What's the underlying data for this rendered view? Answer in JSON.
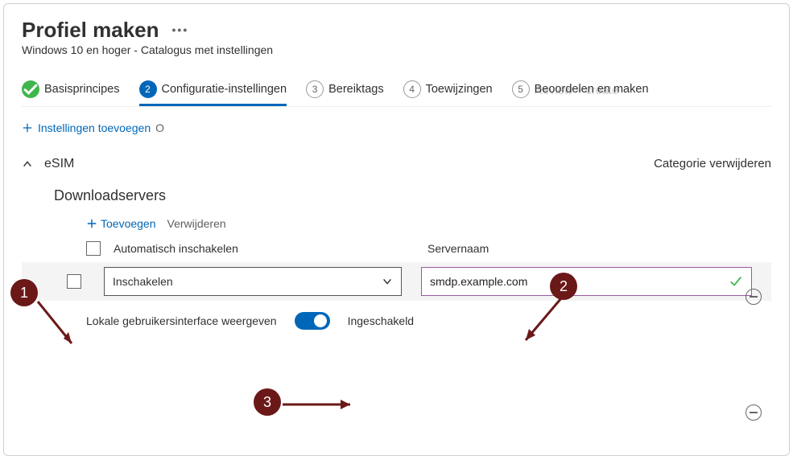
{
  "page_title": "Profiel maken",
  "subtitle": "Windows 10 en hoger - Catalogus met instellingen",
  "steps": {
    "s1": "Basisprincipes",
    "s2": "Configuratie-instellingen",
    "s3": "Bereiktags",
    "s4": "Toewijzingen",
    "s5": "Beoordelen en maken",
    "ghost": "Review + create"
  },
  "add_settings": "Instellingen toevoegen",
  "section": {
    "name": "eSIM",
    "remove": "Categorie verwijderen",
    "subsection": "Downloadservers"
  },
  "toolbar": {
    "add": "Toevoegen",
    "remove": "Verwijderen"
  },
  "columns": {
    "auto_enable": "Automatisch inschakelen",
    "server_name": "Servernaam"
  },
  "row": {
    "combo_value": "Inschakelen",
    "server_value": "smdp.example.com"
  },
  "ui_toggle": {
    "label": "Lokale gebruikersinterface weergeven",
    "state": "Ingeschakeld"
  },
  "annotations": {
    "c1": "1",
    "c2": "2",
    "c3": "3"
  }
}
